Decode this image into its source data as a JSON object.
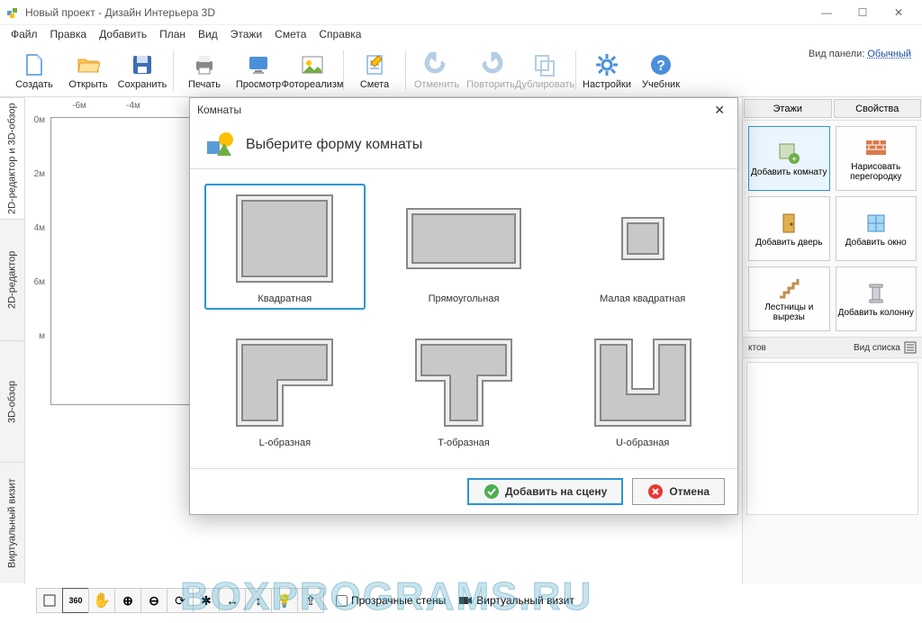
{
  "window": {
    "title": "Новый проект - Дизайн Интерьера 3D"
  },
  "menu": [
    "Файл",
    "Правка",
    "Добавить",
    "План",
    "Вид",
    "Этажи",
    "Смета",
    "Справка"
  ],
  "toolbar": {
    "create": "Создать",
    "open": "Открыть",
    "save": "Сохранить",
    "print": "Печать",
    "preview": "Просмотр",
    "photorealism": "Фотореализм",
    "estimate": "Смета",
    "undo": "Отменить",
    "redo": "Повторить",
    "duplicate": "Дублировать",
    "settings": "Настройки",
    "tutorial": "Учебник"
  },
  "view_panel": {
    "label": "Вид панели:",
    "value": "Обычный"
  },
  "side_tabs": [
    "2D-редактор и 3D-обзор",
    "2D-редактор",
    "3D-обзор",
    "Виртуальный визит"
  ],
  "ruler_h": [
    "-6м",
    "-4м"
  ],
  "ruler_v": [
    "0м",
    "2м",
    "4м",
    "6м",
    "м"
  ],
  "right_tabs": [
    "Этажи",
    "Свойства"
  ],
  "right_tools": {
    "add_room": "Добавить комнату",
    "draw_wall": "Нарисовать перегородку",
    "add_door": "Добавить дверь",
    "add_window": "Добавить окно",
    "stairs": "Лестницы и вырезы",
    "add_column": "Добавить колонну"
  },
  "right_footer": {
    "left_suffix": "ктов",
    "right": "Вид списка"
  },
  "modal": {
    "header": "Комнаты",
    "title": "Выберите форму комнаты",
    "shapes": {
      "square": "Квадратная",
      "rect": "Прямоугольная",
      "small_square": "Малая квадратная",
      "l": "L-образная",
      "t": "T-образная",
      "u": "U-образная"
    },
    "add": "Добавить на сцену",
    "cancel": "Отмена"
  },
  "statusbar": {
    "transparent_walls": "Прозрачные стены",
    "virtual_visit": "Виртуальный визит"
  },
  "watermark": "BOXPROGRAMS.RU"
}
